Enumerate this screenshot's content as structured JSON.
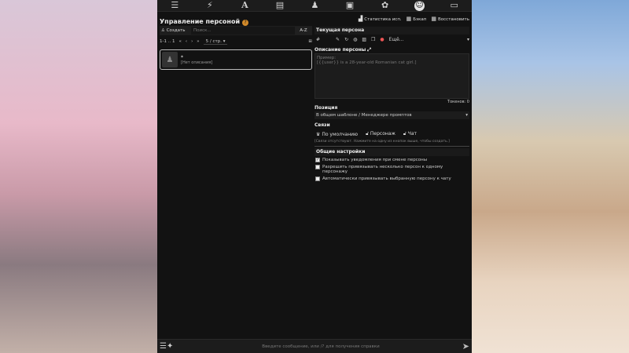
{
  "topbar": {
    "icons": [
      "sliders-icon",
      "plug-icon",
      "font-icon",
      "book-icon",
      "users-icon",
      "image-icon",
      "cubes-icon",
      "face-smile-icon",
      "id-card-icon"
    ]
  },
  "header": {
    "title": "Управление персоной",
    "stats_label": "Статистика исп.",
    "backup_label": "Бэкап",
    "restore_label": "Восстановить"
  },
  "left": {
    "create_label": "Создать",
    "search_placeholder": "Поиск...",
    "sort_value": "A-Z",
    "pager": {
      "range": "1-1 .. 1",
      "per_page": "5 / стр."
    },
    "persona": {
      "name": "*",
      "description": "[Нет описания]"
    }
  },
  "right": {
    "current_title": "Текущая персона",
    "current_name": "#",
    "dropdown_value": "Ещё...",
    "desc_label": "Описание персоны",
    "desc_placeholder_line1": "Пример:",
    "desc_placeholder_line2": "[{{user}} is a 28-year-old Romanian cat girl.]",
    "tokens": "Токенов: 0",
    "position_label": "Позиция",
    "position_value": "В общем шаблоне / Менеджере промптов",
    "links_label": "Связи",
    "link_default": "По умолчанию",
    "link_chat_char": "Персонаж",
    "link_chat": "Чат",
    "links_note": "[Связи отсутствуют. Нажмите на одну из кнопок выше, чтобы создать.]",
    "general_label": "Общие настройки",
    "opt1": "Показывать уведомления при смене персоны",
    "opt2": "Разрешить привязывать несколько персон к одному персонажу",
    "opt3": "Автоматически привязывать выбранную персону к чату"
  },
  "bottom": {
    "placeholder": "Введите сообщение, или /? для получения справки"
  }
}
